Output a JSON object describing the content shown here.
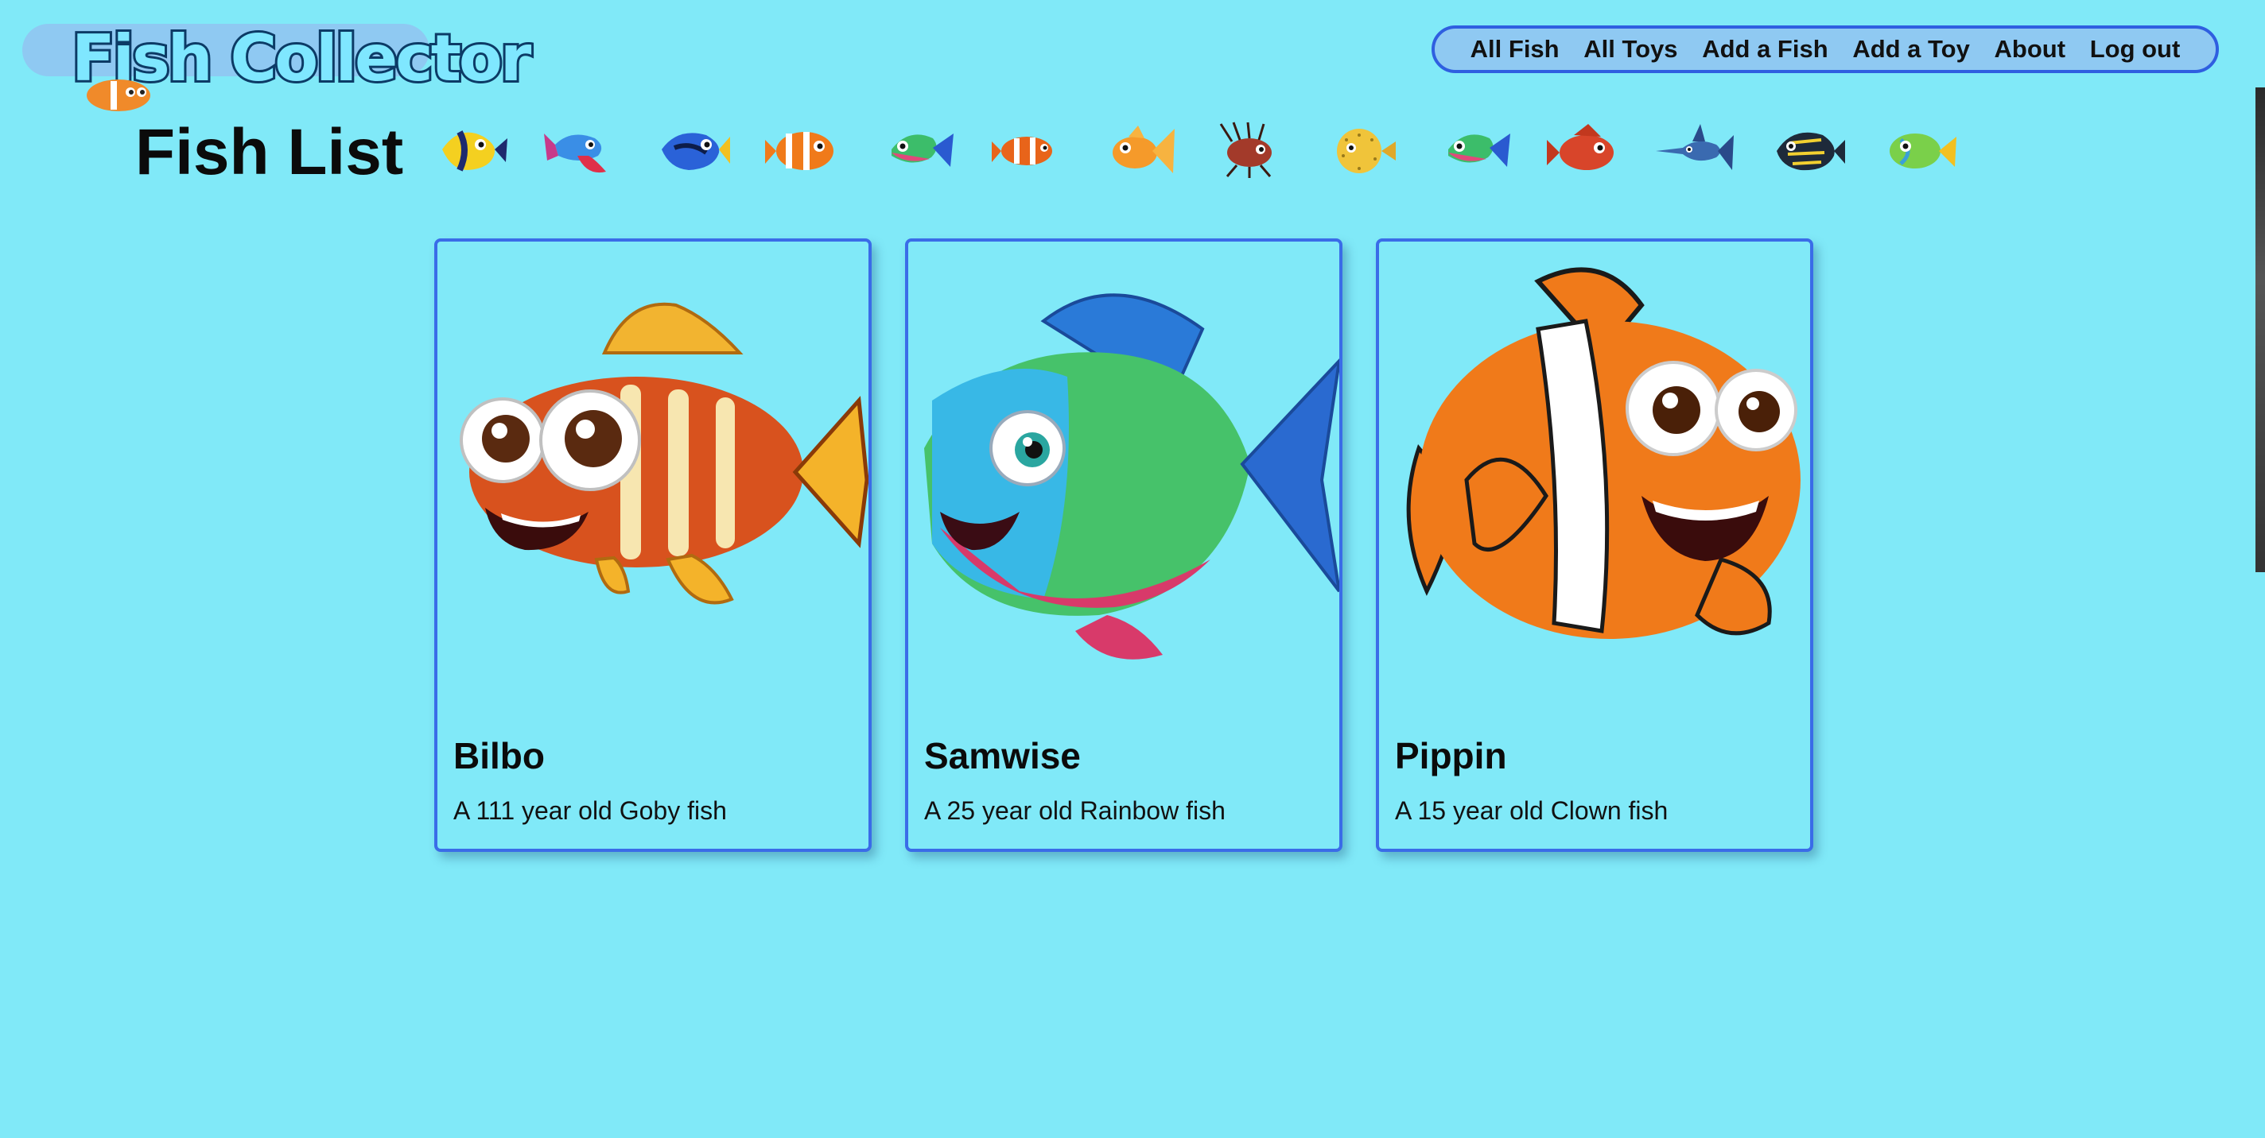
{
  "app": {
    "logo_text": "Fish Collector"
  },
  "nav": {
    "items": [
      {
        "label": "All Fish"
      },
      {
        "label": "All Toys"
      },
      {
        "label": "Add a Fish"
      },
      {
        "label": "Add a Toy"
      },
      {
        "label": "About"
      },
      {
        "label": "Log out"
      }
    ]
  },
  "page": {
    "title": "Fish List"
  },
  "fish_icons": [
    "yellow-tang-icon",
    "betta-icon",
    "blue-tang-icon",
    "clownfish-icon",
    "rainbow-fish-icon",
    "small-clownfish-icon",
    "goldfish-icon",
    "lionfish-icon",
    "pufferfish-icon",
    "rainbow-fish-icon",
    "red-fish-icon",
    "swordfish-icon",
    "triggerfish-icon",
    "green-fish-icon"
  ],
  "cards": [
    {
      "name": "Bilbo",
      "description": "A 111 year old Goby fish"
    },
    {
      "name": "Samwise",
      "description": "A 25 year old Rainbow fish"
    },
    {
      "name": "Pippin",
      "description": "A 15 year old Clown fish"
    }
  ],
  "colors": {
    "background": "#80e9f8",
    "accent_border": "#3a6ce8",
    "nav_fill": "#8fc9f2"
  }
}
